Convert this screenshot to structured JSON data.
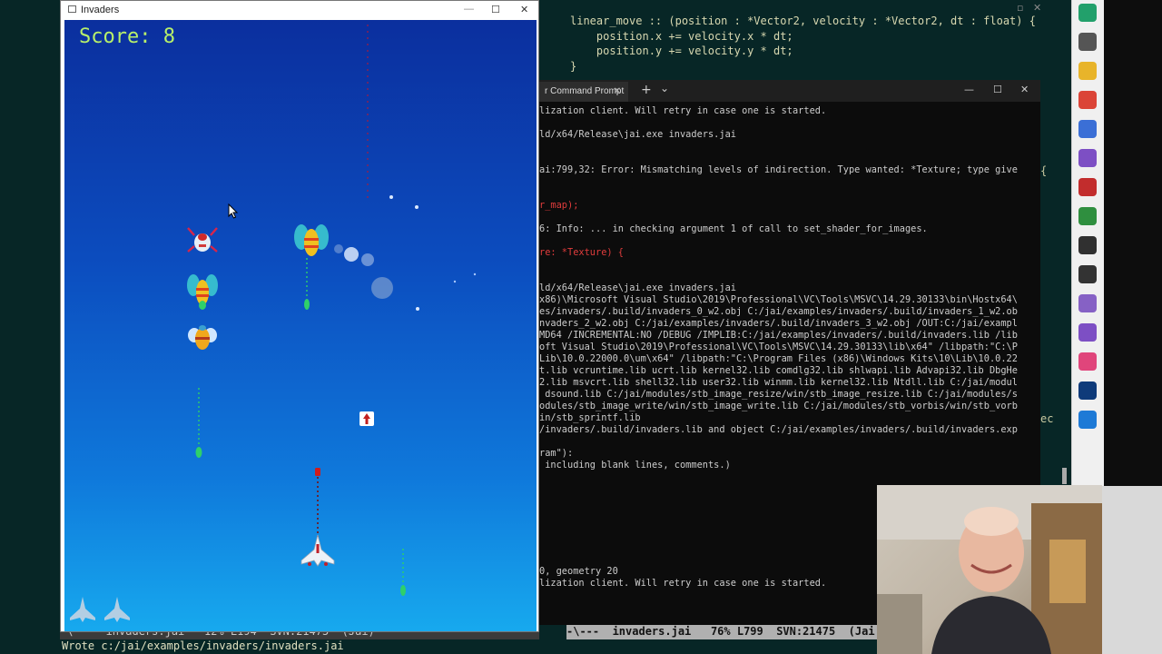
{
  "game_window": {
    "title": "Invaders",
    "controls": {
      "minimize": "—",
      "maximize": "☐",
      "close": "✕"
    },
    "score_text": "Score: 8"
  },
  "editor": {
    "code_lines": [
      "linear_move :: (position : *Vector2, velocity : *Vector2, dt : float) {",
      "    position.x += velocity.x * dt;",
      "    position.y += velocity.y * dt;",
      "}"
    ],
    "modeline_left": "-\\---  invaders.jai   12% L194  SVN:21475  (Jai)",
    "modeline_right": "-\\---  invaders.jai   76% L799  SVN:21475  (Jai",
    "minibuffer": "Wrote c:/jai/examples/invaders/invaders.jai",
    "right_fragment_1": "{",
    "right_fragment_2": "ec"
  },
  "terminal": {
    "tab_label": "r Command Prompt",
    "new_tab": "+",
    "dropdown": "⌄",
    "controls": {
      "minimize": "—",
      "maximize": "☐",
      "close": "✕"
    },
    "lines": [
      {
        "text": "lization client. Will retry in case one is started.",
        "red": false
      },
      {
        "text": "",
        "red": false
      },
      {
        "text": "ld/x64/Release\\jai.exe invaders.jai",
        "red": false
      },
      {
        "text": "",
        "red": false
      },
      {
        "text": "",
        "red": false
      },
      {
        "text": "ai:799,32: Error: Mismatching levels of indirection. Type wanted: *Texture; type give",
        "red": false
      },
      {
        "text": "",
        "red": false
      },
      {
        "text": "",
        "red": false
      },
      {
        "text": "r_map);",
        "red": true
      },
      {
        "text": "",
        "red": false
      },
      {
        "text": "6: Info: ... in checking argument 1 of call to set_shader_for_images.",
        "red": false
      },
      {
        "text": "",
        "red": false
      },
      {
        "text": "re: *Texture) {",
        "red": true
      },
      {
        "text": "",
        "red": false
      },
      {
        "text": "",
        "red": false
      },
      {
        "text": "ld/x64/Release\\jai.exe invaders.jai",
        "red": false
      },
      {
        "text": "x86)\\Microsoft Visual Studio\\2019\\Professional\\VC\\Tools\\MSVC\\14.29.30133\\bin\\Hostx64\\",
        "red": false
      },
      {
        "text": "es/invaders/.build/invaders_0_w2.obj C:/jai/examples/invaders/.build/invaders_1_w2.ob",
        "red": false
      },
      {
        "text": "nvaders_2_w2.obj C:/jai/examples/invaders/.build/invaders_3_w2.obj /OUT:C:/jai/exampl",
        "red": false
      },
      {
        "text": "MD64 /INCREMENTAL:NO /DEBUG /IMPLIB:C:/jai/examples/invaders/.build/invaders.lib /lib",
        "red": false
      },
      {
        "text": "oft Visual Studio\\2019\\Professional\\VC\\Tools\\MSVC\\14.29.30133\\lib\\x64\" /libpath:\"C:\\P",
        "red": false
      },
      {
        "text": "Lib\\10.0.22000.0\\um\\x64\" /libpath:\"C:\\Program Files (x86)\\Windows Kits\\10\\Lib\\10.0.22",
        "red": false
      },
      {
        "text": "t.lib vcruntime.lib ucrt.lib kernel32.lib comdlg32.lib shlwapi.lib Advapi32.lib DbgHe",
        "red": false
      },
      {
        "text": "2.lib msvcrt.lib shell32.lib user32.lib winmm.lib kernel32.lib Ntdll.lib C:/jai/modul",
        "red": false
      },
      {
        "text": " dsound.lib C:/jai/modules/stb_image_resize/win/stb_image_resize.lib C:/jai/modules/s",
        "red": false
      },
      {
        "text": "odules/stb_image_write/win/stb_image_write.lib C:/jai/modules/stb_vorbis/win/stb_vorb",
        "red": false
      },
      {
        "text": "in/stb_sprintf.lib",
        "red": false
      },
      {
        "text": "/invaders/.build/invaders.lib and object C:/jai/examples/invaders/.build/invaders.exp",
        "red": false
      },
      {
        "text": "",
        "red": false
      },
      {
        "text": "ram\"):",
        "red": false
      },
      {
        "text": " including blank lines, comments.)",
        "red": false
      },
      {
        "text": "",
        "red": false
      },
      {
        "text": "",
        "red": false
      },
      {
        "text": "",
        "red": false
      },
      {
        "text": "",
        "red": false
      },
      {
        "text": "",
        "red": false
      },
      {
        "text": "",
        "red": false
      },
      {
        "text": "",
        "red": false
      },
      {
        "text": "",
        "red": false
      },
      {
        "text": "0, geometry 20",
        "red": false
      },
      {
        "text": "lization client. Will retry in case one is started.",
        "red": false
      }
    ]
  },
  "taskbar": {
    "icons": [
      {
        "name": "apps-icon",
        "color": "#22a06b"
      },
      {
        "name": "search-icon",
        "color": "#555555"
      },
      {
        "name": "folder-icon",
        "color": "#e8b42a"
      },
      {
        "name": "chrome-icon",
        "color": "#db4437"
      },
      {
        "name": "app-blue-icon",
        "color": "#3b6fd6"
      },
      {
        "name": "emacs-icon",
        "color": "#7d4fc4"
      },
      {
        "name": "red-app-icon",
        "color": "#c22d2d"
      },
      {
        "name": "green-app-icon",
        "color": "#2f8f3f"
      },
      {
        "name": "obs-icon",
        "color": "#303030"
      },
      {
        "name": "terminal-icon",
        "color": "#333333"
      },
      {
        "name": "visual-studio-icon",
        "color": "#8661c5"
      },
      {
        "name": "emacs-2-icon",
        "color": "#7d4fc4"
      },
      {
        "name": "camera-app-icon",
        "color": "#e0457b"
      },
      {
        "name": "photoshop-icon",
        "color": "#0f3b7a"
      },
      {
        "name": "window-icon",
        "color": "#1e7ad6"
      }
    ]
  },
  "colors": {
    "score": "#b8f06a",
    "editor_bg": "#072626",
    "terminal_bg": "#0c0c0c",
    "player_bullet": "#d01c1c",
    "enemy_bullet": "#2fd06a"
  }
}
